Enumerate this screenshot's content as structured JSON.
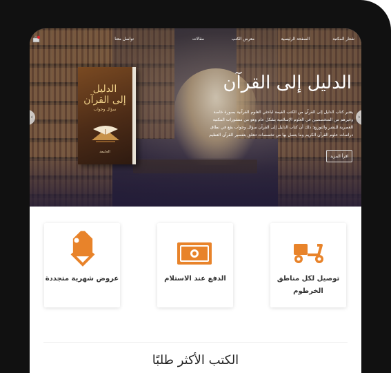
{
  "nav": {
    "items": [
      {
        "label": "شعار المكتبة"
      },
      {
        "label": "الصفحة الرئيسية"
      },
      {
        "label": "معرض الكتب"
      },
      {
        "label": "مقالات"
      },
      {
        "label": "تواصل معنا"
      }
    ],
    "cart_icon": "cart-icon"
  },
  "hero": {
    "title": "الدليل إلى القرآن",
    "description": "يعتبر كتاب الدليل إلى القرآن من الكتب القيمة لباحثي العلوم القرآنية بصورة خاصة وغيرهم من المتخصصين في العلوم الإسلامية بشكل عام وهو من منشورات المكتبة العصرية للنشر والتوزيع؛ ذلك أن كتاب الدليل إلى القرآن سؤال وجواب يقع في نطاق دراسات علوم القرآن الكريم وما يتصل بها من تخصصات تتعلق بتفسير القرآن العظيم",
    "button_label": "اقرأ المزيد",
    "prev_icon": "chevron-left-icon",
    "next_icon": "chevron-right-icon",
    "book": {
      "title_line1": "الدليل",
      "title_line2": "إلى القرآن",
      "subtitle": "سؤال وجواب",
      "author": "الجامعة"
    }
  },
  "features": [
    {
      "icon": "price-tag-icon",
      "label": "عروض شهرية متجددة"
    },
    {
      "icon": "money-bill-icon",
      "label": "الدفع عند الاستلام"
    },
    {
      "icon": "delivery-scooter-icon",
      "label": "توصيل لكل مناطق الخرطوم"
    }
  ],
  "section": {
    "title": "الكتب الأكثر طلبًا"
  },
  "colors": {
    "accent": "#e8832a",
    "device_frame": "#111111"
  }
}
